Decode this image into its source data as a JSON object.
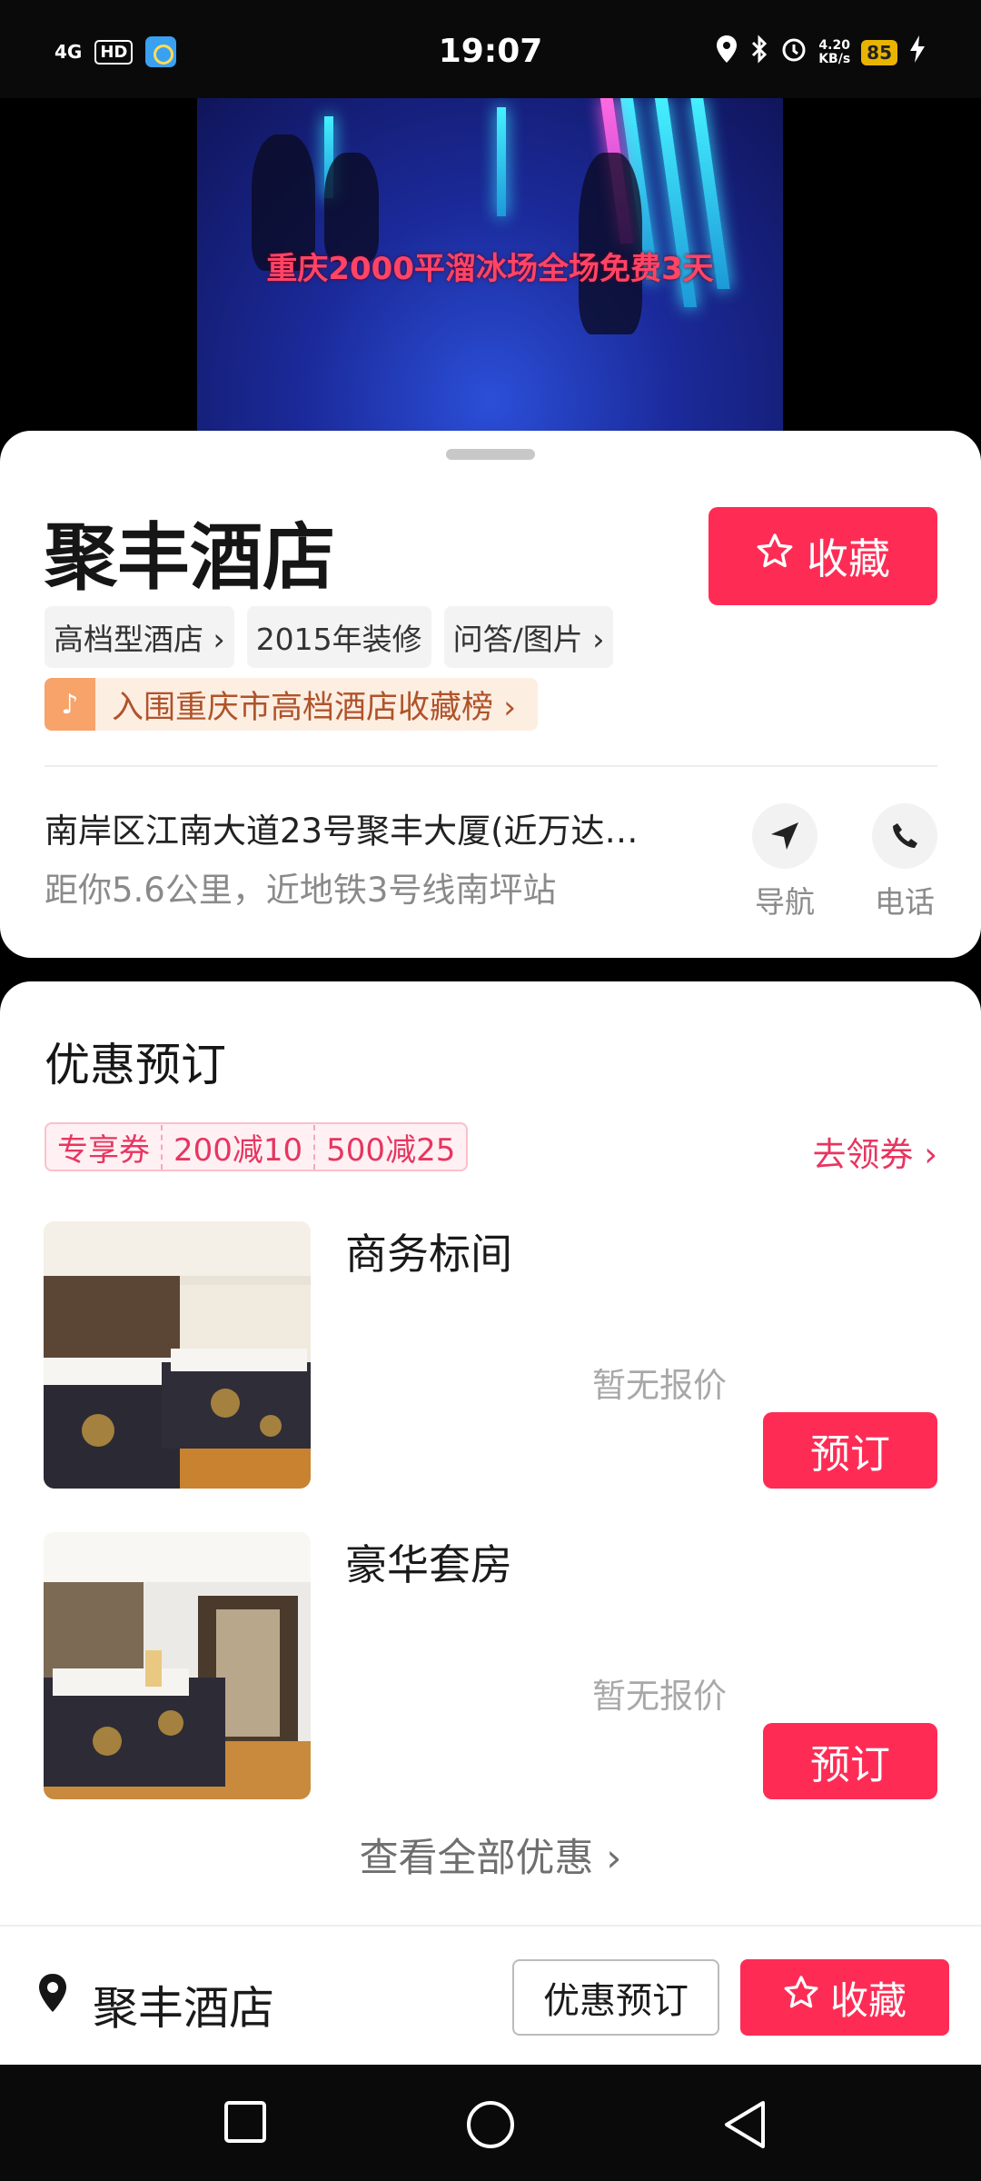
{
  "status_bar": {
    "network": "4G",
    "hd": "HD",
    "time": "19:07",
    "speed_value": "4.20",
    "speed_unit": "KB/s",
    "battery": "85"
  },
  "video": {
    "caption": "重庆2000平溜冰场全场免费3天"
  },
  "hotel": {
    "name": "聚丰酒店",
    "favorite_label": "收藏",
    "tags": [
      "高档型酒店 ›",
      "2015年装修",
      "问答/图片 ›"
    ],
    "rank_text": "入围重庆市高档酒店收藏榜 ›",
    "address": "南岸区江南大道23号聚丰大厦(近万达…",
    "distance": "距你5.6公里，近地铁3号线南坪站",
    "actions": {
      "navigate": "导航",
      "phone": "电话"
    }
  },
  "deals": {
    "title": "优惠预订",
    "coupons": [
      "专享券",
      "200减10",
      "500减25"
    ],
    "get_coupon": "去领券 ›",
    "rooms": [
      {
        "name": "商务标间",
        "price": "暂无报价",
        "book": "预订"
      },
      {
        "name": "豪华套房",
        "price": "暂无报价",
        "book": "预订"
      }
    ],
    "view_all": "查看全部优惠 ›"
  },
  "bottom_bar": {
    "name": "聚丰酒店",
    "deal_button": "优惠预订",
    "favorite_button": "收藏"
  },
  "colors": {
    "accent": "#fe2c55",
    "coupon_text": "#e63660",
    "rank_text": "#b0532a"
  },
  "icons": [
    "star-icon",
    "navigation-arrow-icon",
    "phone-icon",
    "location-pin-icon",
    "square-icon",
    "circle-icon",
    "back-triangle-icon"
  ]
}
